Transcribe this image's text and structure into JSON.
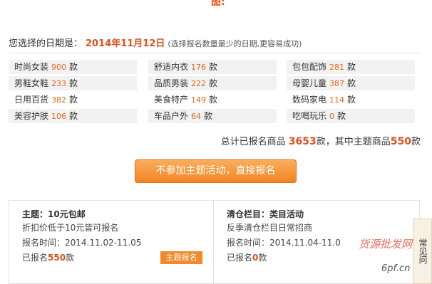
{
  "top_fragment": "图:",
  "header": {
    "label": "您选择的日期是：",
    "date": "2014年11月12日",
    "hint": "(选择报名数量最少的日期,更容易成功)"
  },
  "category_unit": "款",
  "categories": [
    {
      "name": "时尚女装",
      "count": "900"
    },
    {
      "name": "舒适内衣",
      "count": "176"
    },
    {
      "name": "包包配饰",
      "count": "281"
    },
    {
      "name": "男鞋女鞋",
      "count": "233"
    },
    {
      "name": "品质男装",
      "count": "222"
    },
    {
      "name": "母婴儿童",
      "count": "387"
    },
    {
      "name": "日用百货",
      "count": "382"
    },
    {
      "name": "美食特产",
      "count": "149"
    },
    {
      "name": "数码家电",
      "count": "114"
    },
    {
      "name": "美容护肤",
      "count": "106"
    },
    {
      "name": "车品户外",
      "count": "64"
    },
    {
      "name": "吃喝玩乐",
      "count": "0"
    }
  ],
  "total": {
    "prefix": "总计已报名商品",
    "total_count": "3653",
    "middle": "款，其中主题商品",
    "theme_count": "550",
    "suffix": "款"
  },
  "cta_label": "不参加主题活动，直接报名",
  "cards": [
    {
      "title": "主题：10元包邮",
      "desc": "折扣价低于10元皆可报名",
      "time_label": "报名时间：",
      "time": "2014.11.02-11.05",
      "signed_prefix": "已报名",
      "signed_count": "550",
      "signed_suffix": "款",
      "button": "主题报名"
    },
    {
      "title": "清仓栏目：类目活动",
      "desc": "反季清仓栏目日常招商",
      "time_label": "报名时间：",
      "time": "2014.11.04-11.0",
      "signed_prefix": "已报名",
      "signed_count": "0",
      "signed_suffix": "款"
    }
  ],
  "side_tab": "常见问",
  "watermark": {
    "text": "货源批发网",
    "url": "6pf.cn"
  }
}
